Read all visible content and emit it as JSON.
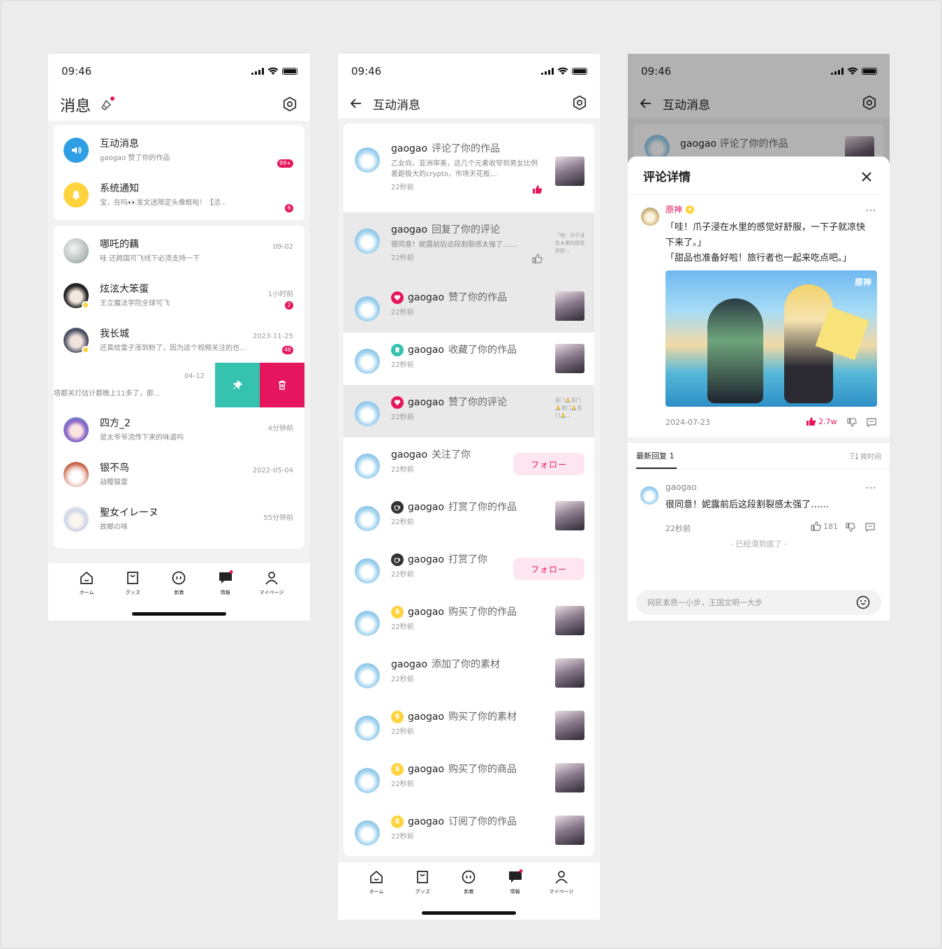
{
  "status_time": "09:46",
  "nav": [
    "ホーム",
    "グッズ",
    "新着",
    "情報",
    "マイページ"
  ],
  "screen1": {
    "title": "消息",
    "system": [
      {
        "name": "互动消息",
        "preview": "gaogao 赞了你的作品",
        "badge": "99+"
      },
      {
        "name": "系统通知",
        "preview": "宝，在吗👀发文送限定头像框啦！【活...",
        "badge": "6"
      }
    ],
    "chats": [
      {
        "name": "哪吒的藕",
        "preview": "哇 还跨国可飞线下必须支持一下",
        "time": "09-02",
        "badge": ""
      },
      {
        "name": "炫泫大笨蛋",
        "preview": "王立魔法学院全球可飞",
        "time": "1小时前",
        "badge": "2"
      },
      {
        "name": "我长城",
        "preview": "还真给雷子涨到粉了，因为这个视频关注的也…",
        "time": "2023-11-25",
        "badge": "46"
      },
      {
        "name": "",
        "preview": "塔都关灯估计都晚上11多了，那…",
        "time": "04-12",
        "badge": ""
      },
      {
        "name": "四方_2",
        "preview": "是太爷爷流传下来的味道吗",
        "time": "4分钟前",
        "badge": ""
      },
      {
        "name": "银不鸟",
        "preview": "战樱猫雷",
        "time": "2022-05-04",
        "badge": ""
      },
      {
        "name": "聖女イレーヌ",
        "preview": "故郷の味",
        "time": "55分钟前",
        "badge": ""
      }
    ]
  },
  "screen2": {
    "title": "互动消息",
    "follow_label": "フォロー",
    "items": [
      {
        "user": "gaogao",
        "action": "评论了你的作品",
        "sub": "乙女向，亚洲审美，这几个元素收窄到男女比例差距极大的crypto，市场天花板…",
        "time": "22秒前",
        "icon": "",
        "right": "thumb",
        "gray": false
      },
      {
        "user": "gaogao",
        "action": "回复了你的评论",
        "sub": "很同意！妮露前后这段割裂感太强了……",
        "time": "22秒前",
        "icon": "",
        "right": "quote",
        "quote": "「哇！爪子浸在水里的感觉好舒…",
        "gray": true
      },
      {
        "user": "gaogao",
        "action": "赞了你的作品",
        "sub": "",
        "time": "22秒前",
        "icon": "heart",
        "right": "thumb",
        "gray": true
      },
      {
        "user": "gaogao",
        "action": "收藏了你的作品",
        "sub": "",
        "time": "22秒前",
        "icon": "bookmark",
        "right": "thumb",
        "gray": false
      },
      {
        "user": "gaogao",
        "action": "赞了你的评论",
        "sub": "",
        "time": "22秒前",
        "icon": "heart",
        "right": "quote",
        "quote": "吾门🙏吾门🙏吾门🙏吾门🙏…",
        "gray": true
      },
      {
        "user": "gaogao",
        "action": "关注了你",
        "sub": "",
        "time": "22秒前",
        "icon": "",
        "right": "follow",
        "gray": false
      },
      {
        "user": "gaogao",
        "action": "打赏了你的作品",
        "sub": "",
        "time": "22秒前",
        "icon": "cup",
        "right": "thumb",
        "gray": false
      },
      {
        "user": "gaogao",
        "action": "打赏了你",
        "sub": "",
        "time": "22秒前",
        "icon": "cup",
        "right": "follow",
        "gray": false
      },
      {
        "user": "gaogao",
        "action": "购买了你的作品",
        "sub": "",
        "time": "22秒前",
        "icon": "coin",
        "right": "thumb",
        "gray": false
      },
      {
        "user": "gaogao",
        "action": "添加了你的素材",
        "sub": "",
        "time": "22秒前",
        "icon": "",
        "right": "thumb",
        "gray": false
      },
      {
        "user": "gaogao",
        "action": "购买了你的素材",
        "sub": "",
        "time": "22秒前",
        "icon": "coin",
        "right": "thumb",
        "gray": false
      },
      {
        "user": "gaogao",
        "action": "购买了你的商品",
        "sub": "",
        "time": "22秒前",
        "icon": "coin",
        "right": "thumb",
        "gray": false
      },
      {
        "user": "gaogao",
        "action": "订阅了你的作品",
        "sub": "",
        "time": "22秒前",
        "icon": "coin",
        "right": "thumb",
        "gray": false
      }
    ]
  },
  "screen3": {
    "title": "互动消息",
    "bg_item": {
      "user": "gaogao",
      "action": "评论了你的作品"
    },
    "sheet_title": "评论详情",
    "author": "原神",
    "comment_line1": "「哇！爪子浸在水里的感觉好舒服，一下子就凉快下来了。」",
    "comment_line2": "「甜品也准备好啦！旅行者也一起来吃点吧。」",
    "image_logo": "原神",
    "date": "2024-07-23",
    "likes": "2.7w",
    "replies_tab": "最新回复 1",
    "sort_label": "按时间",
    "reply": {
      "user": "gaogao",
      "text": "很同意！妮露前后这段割裂感太强了……",
      "time": "22秒前",
      "likes": "181"
    },
    "end_text": "- 已经滑到底了 -",
    "input_placeholder": "网民素质一小步，王国文明一大步"
  },
  "colors": {
    "accent": "#e5165e",
    "teal": "#35c3b0",
    "blue": "#2e9ee5",
    "yellow": "#ffd33d"
  }
}
